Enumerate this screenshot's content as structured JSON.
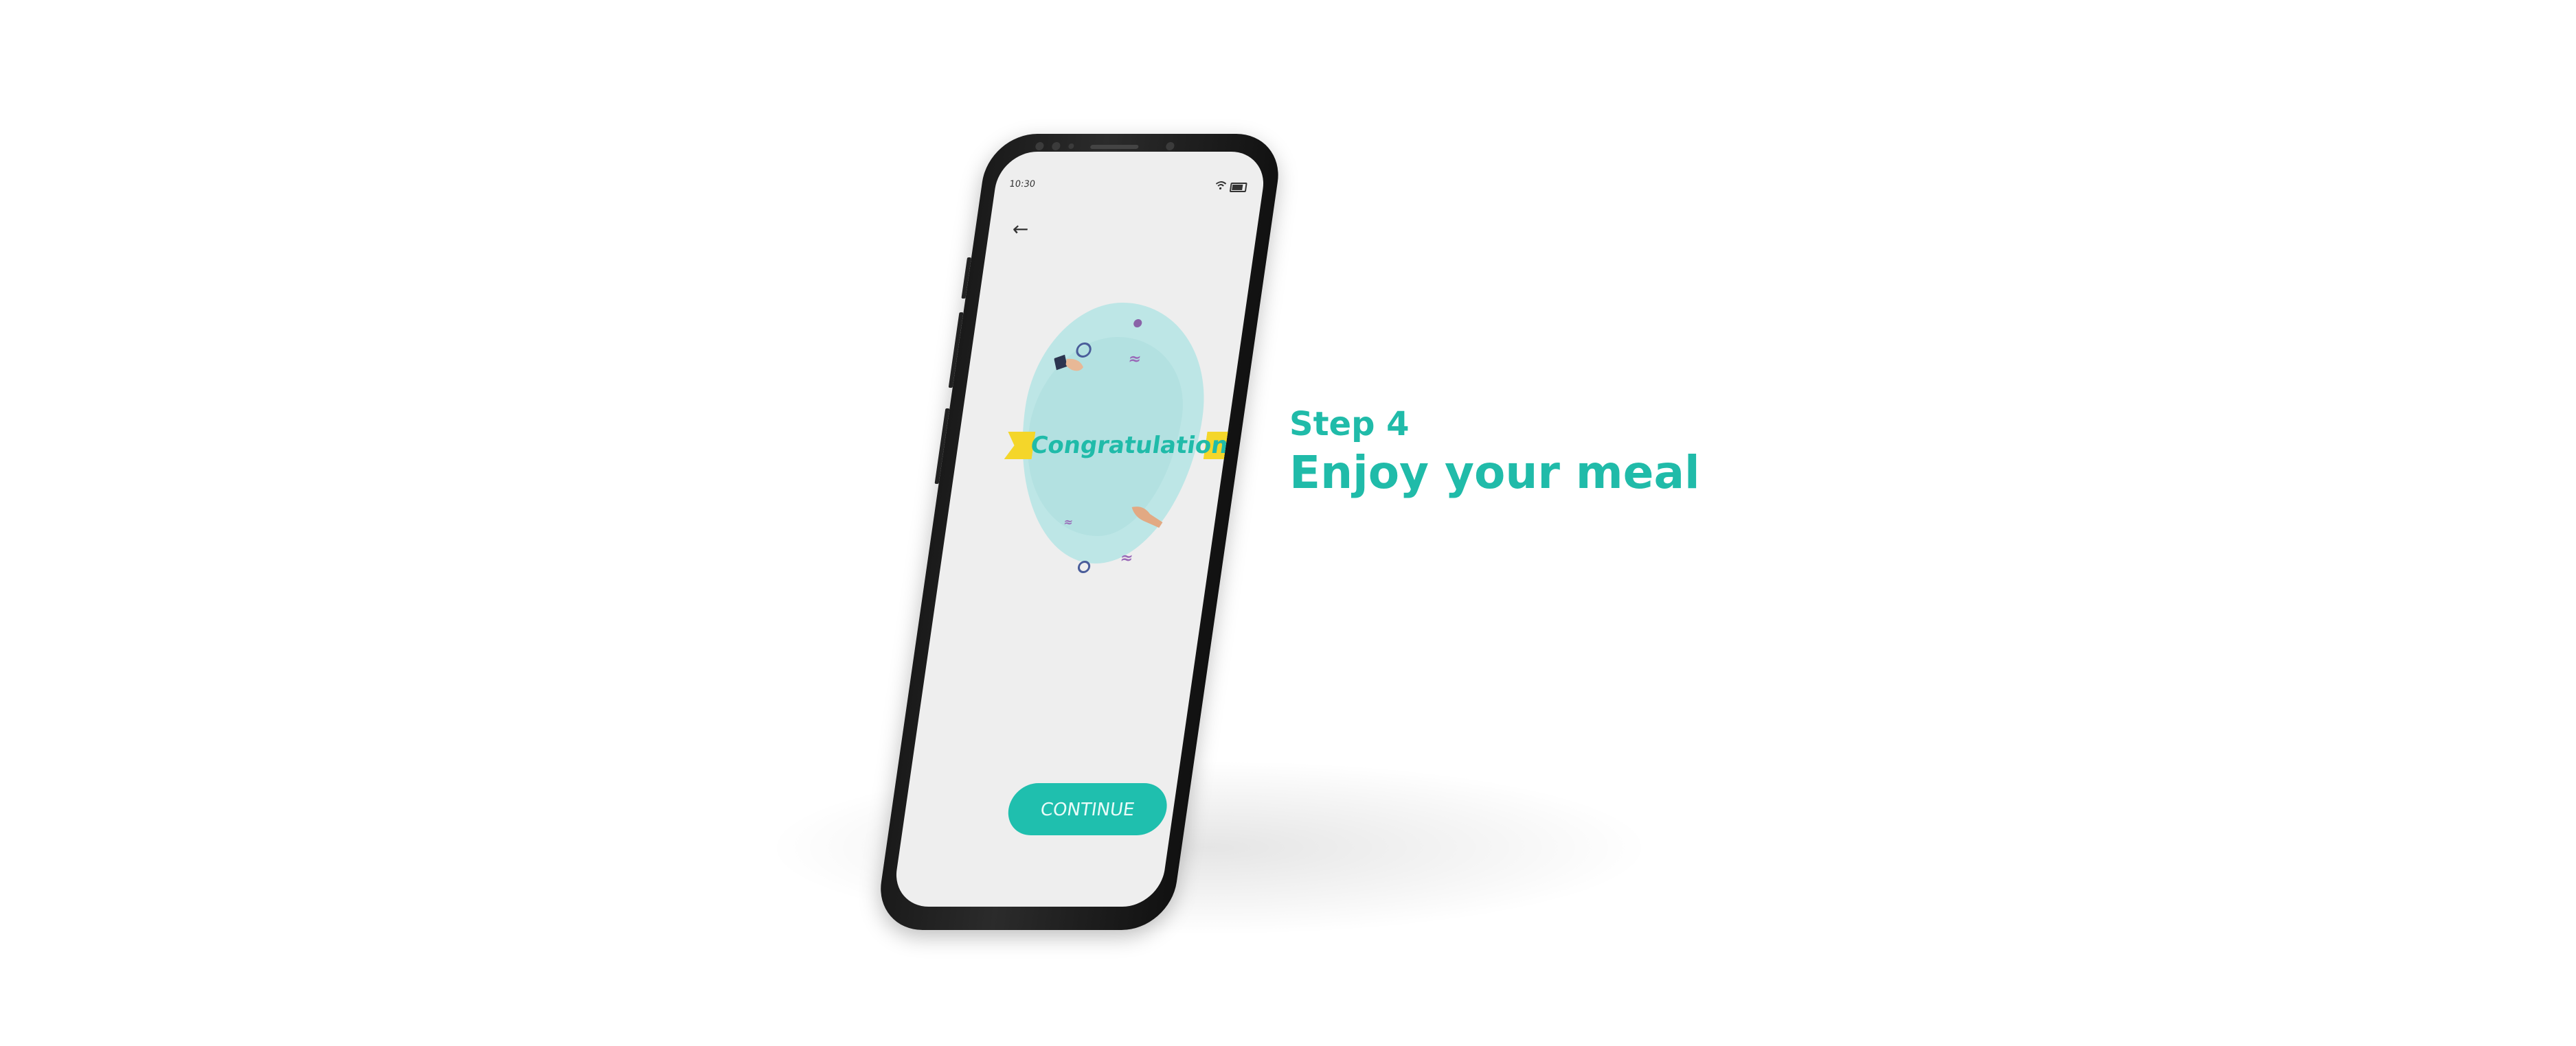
{
  "colors": {
    "accent": "#20bba9",
    "button": "#1fbfae",
    "ribbon": "#f4d62a",
    "screen_bg": "#eeeeee",
    "blob": "#bde6e6"
  },
  "phone": {
    "status_bar": {
      "time": "10:30",
      "wifi_icon": "wifi-icon",
      "battery_icon": "battery-icon"
    },
    "back_icon": "arrow-left-icon",
    "back_glyph": "←",
    "illustration": {
      "banner_text": "Congratulations"
    },
    "continue_label": "CONTINUE"
  },
  "caption": {
    "step": "Step 4",
    "title": "Enjoy your meal"
  }
}
